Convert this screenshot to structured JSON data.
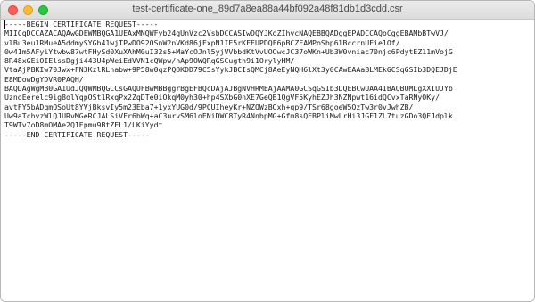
{
  "window": {
    "title": "test-certificate-one_89d7a8ea88a44bf092a48f81db1d3cdd.csr"
  },
  "document": {
    "lines": [
      "-----BEGIN CERTIFICATE REQUEST-----",
      "MIICqDCCAZACAQAwGDEWMBQGA1UEAxMNQWFyb24gUnVzc2VsbDCCASIwDQYJKoZIhvcNAQEBBQADggEPADCCAQoCggEBAMbBTwVJ/",
      "vlBu3eu1RMueA5ddmySYGb41wjTPwDO92OSnW2nVKd86jFxpN1IE5rKFEUPDQF6pBCZFAMPoSbp6lBccrnUFie1Of/",
      "0w41m5AFyiYtwbw87wtFHySd0XuXAhM0uI32s5+MaYcOJnl5yjVVbbdKtVvUOOwcJC37oWKn+Ub3W0vniac70njc6PdytEZ11mVojG",
      "8R48xGEiOIElssDgji443U4pWeiEdVVN1cQWpw/nAp9OWQRqGSCugth9i1OrylyHM/",
      "VtaAjPBKIw70Jwx+FN3KzlRLhabw+9P58w0qzPQOKDD79C5sYykJBCIsQMCj8AeEyNQH6lXt3y0CAwEAAaBLMEkGCSqGSIb3DQEJDjE",
      "E8MDowDgYDVR0PAQH/",
      "BAQDAgWgMB0GA1UdJQQWMBQGCCsGAQUFBwMBBggrBgEFBQcDAjAJBgNVHRMEAjAAMA0GCSqGSIb3DQEBCwUAA4IBAQBUMLgXXIUJYb",
      "UznoEerelc9ig8olYqpOSt1RxqPx2ZqDTe0iOkqM0yh30+hp4SXbG0nXE7GeQB1QgVF5KyhEZJh3NZNpwt16idQCvxTaRNyOKy/",
      "avtFY5bADqmQSoUt8YVjBksvIy5m23Eba7+1yxYUG0d/9PCUIheyKr+NZQWzBOxh+qp9/TSr68goeW5QzTw3r0vJwhZB/",
      "Uw9aTchvzWlQJURvMGeRCJALSiVFr6bWq+aC3urvSM6loENiDWC8TyR4NnbpMG+Gfm8sQEBPliMwLrHi3JGF1ZL7tuzGDo3QFJdplk",
      "T9WTv7oD8mOMAe2Q1Epmu9BtZEL1/LKiYydt",
      "-----END CERTIFICATE REQUEST-----"
    ]
  },
  "colors": {
    "close": "#fc5f57",
    "minimize": "#fdbc2e",
    "zoom": "#28c840",
    "text": "#1a1a1a"
  }
}
